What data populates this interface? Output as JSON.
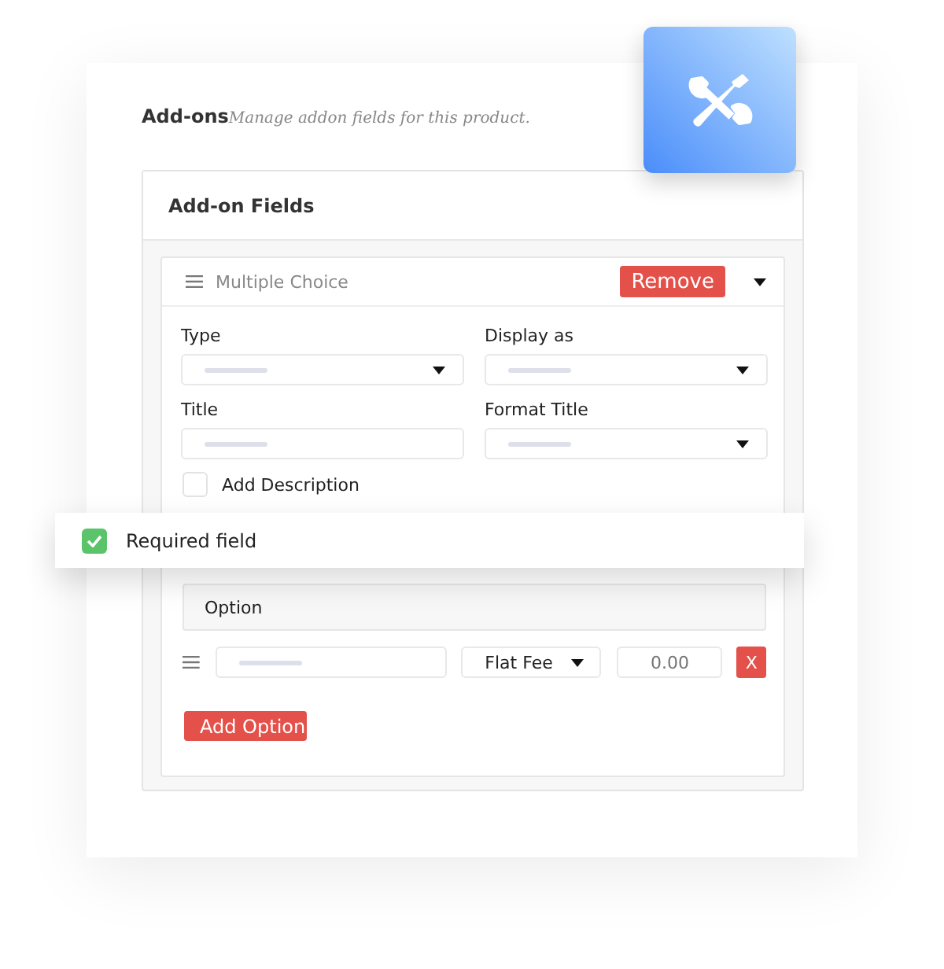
{
  "header": {
    "title": "Add-ons",
    "subtitle": "Manage addon fields for this product."
  },
  "panel": {
    "title": "Add-on Fields"
  },
  "field_group": {
    "title": "Multiple Choice",
    "remove_label": "Remove",
    "expanded": true,
    "fields": [
      {
        "label": "Type",
        "kind": "select"
      },
      {
        "label": "Display as",
        "kind": "select"
      },
      {
        "label": "Title",
        "kind": "text"
      },
      {
        "label": "Format Title",
        "kind": "select"
      }
    ],
    "description": {
      "label": "Add Description",
      "checked": false
    },
    "options_header": "Option",
    "options": [
      {
        "fee_type": "Flat Fee",
        "price_placeholder": "0.00",
        "remove_label": "X"
      }
    ],
    "add_label": "Add Option"
  },
  "toast": {
    "label": "Required field",
    "checked": true
  }
}
